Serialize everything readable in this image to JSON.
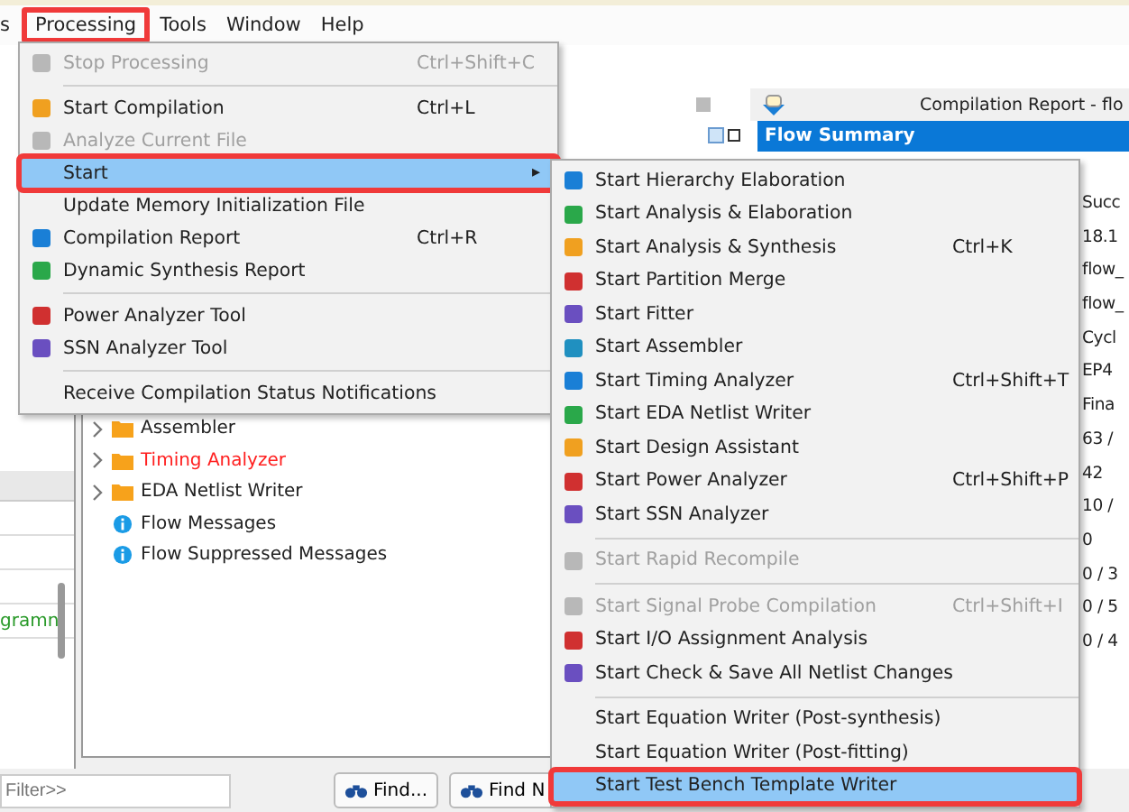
{
  "menubar": [
    {
      "label": "s",
      "annotated": false
    },
    {
      "label": "Processing",
      "annotated": true
    },
    {
      "label": "Tools",
      "annotated": false
    },
    {
      "label": "Window",
      "annotated": false
    },
    {
      "label": "Help",
      "annotated": false
    }
  ],
  "processing_menu": [
    {
      "kind": "item",
      "label": "Stop Processing",
      "shortcut": "Ctrl+Shift+C",
      "disabled": true,
      "selected": false,
      "annotated": false,
      "has_icon": true
    },
    {
      "kind": "separator"
    },
    {
      "kind": "item",
      "label": "Start Compilation",
      "shortcut": "Ctrl+L",
      "disabled": false,
      "selected": false,
      "annotated": false,
      "has_icon": true
    },
    {
      "kind": "item",
      "label": "Analyze Current File",
      "disabled": true,
      "selected": false,
      "annotated": false,
      "has_icon": true
    },
    {
      "kind": "submenu",
      "label": "Start",
      "arrow": "▸",
      "disabled": false,
      "selected": true,
      "annotated": true,
      "has_icon": false
    },
    {
      "kind": "item",
      "label": "Update Memory Initialization File",
      "disabled": false,
      "selected": false,
      "annotated": false,
      "has_icon": false
    },
    {
      "kind": "item",
      "label": "Compilation Report",
      "shortcut": "Ctrl+R",
      "disabled": false,
      "selected": false,
      "annotated": false,
      "has_icon": true
    },
    {
      "kind": "item",
      "label": "Dynamic Synthesis Report",
      "disabled": false,
      "selected": false,
      "annotated": false,
      "has_icon": true
    },
    {
      "kind": "separator"
    },
    {
      "kind": "item",
      "label": "Power Analyzer Tool",
      "disabled": false,
      "selected": false,
      "annotated": false,
      "has_icon": true
    },
    {
      "kind": "item",
      "label": "SSN Analyzer Tool",
      "disabled": false,
      "selected": false,
      "annotated": false,
      "has_icon": true
    },
    {
      "kind": "separator"
    },
    {
      "kind": "item",
      "label": "Receive Compilation Status Notifications",
      "disabled": false,
      "selected": false,
      "annotated": false,
      "has_icon": false
    }
  ],
  "start_submenu": [
    {
      "kind": "item",
      "label": "Start Hierarchy Elaboration",
      "disabled": false,
      "selected": false,
      "annotated": false,
      "has_icon": true
    },
    {
      "kind": "item",
      "label": "Start Analysis & Elaboration",
      "disabled": false,
      "selected": false,
      "annotated": false,
      "has_icon": true
    },
    {
      "kind": "item",
      "label": "Start Analysis & Synthesis",
      "shortcut": "Ctrl+K",
      "disabled": false,
      "selected": false,
      "annotated": false,
      "has_icon": true
    },
    {
      "kind": "item",
      "label": "Start Partition Merge",
      "disabled": false,
      "selected": false,
      "annotated": false,
      "has_icon": true
    },
    {
      "kind": "item",
      "label": "Start Fitter",
      "disabled": false,
      "selected": false,
      "annotated": false,
      "has_icon": true
    },
    {
      "kind": "item",
      "label": "Start Assembler",
      "disabled": false,
      "selected": false,
      "annotated": false,
      "has_icon": true
    },
    {
      "kind": "item",
      "label": "Start Timing Analyzer",
      "shortcut": "Ctrl+Shift+T",
      "disabled": false,
      "selected": false,
      "annotated": false,
      "has_icon": true
    },
    {
      "kind": "item",
      "label": "Start EDA Netlist Writer",
      "disabled": false,
      "selected": false,
      "annotated": false,
      "has_icon": true
    },
    {
      "kind": "item",
      "label": "Start Design Assistant",
      "disabled": false,
      "selected": false,
      "annotated": false,
      "has_icon": true
    },
    {
      "kind": "item",
      "label": "Start Power Analyzer",
      "shortcut": "Ctrl+Shift+P",
      "disabled": false,
      "selected": false,
      "annotated": false,
      "has_icon": true
    },
    {
      "kind": "item",
      "label": "Start SSN Analyzer",
      "disabled": false,
      "selected": false,
      "annotated": false,
      "has_icon": true
    },
    {
      "kind": "separator"
    },
    {
      "kind": "item",
      "label": "Start Rapid Recompile",
      "disabled": true,
      "selected": false,
      "annotated": false,
      "has_icon": true
    },
    {
      "kind": "separator"
    },
    {
      "kind": "item",
      "label": "Start Signal Probe Compilation",
      "shortcut": "Ctrl+Shift+I",
      "disabled": true,
      "selected": false,
      "annotated": false,
      "has_icon": true
    },
    {
      "kind": "item",
      "label": "Start I/O Assignment Analysis",
      "disabled": false,
      "selected": false,
      "annotated": false,
      "has_icon": true
    },
    {
      "kind": "item",
      "label": "Start Check & Save All Netlist Changes",
      "disabled": false,
      "selected": false,
      "annotated": false,
      "has_icon": true
    },
    {
      "kind": "separator"
    },
    {
      "kind": "item",
      "label": "Start Equation Writer (Post-synthesis)",
      "disabled": false,
      "selected": false,
      "annotated": false,
      "has_icon": false
    },
    {
      "kind": "item",
      "label": "Start Equation Writer (Post-fitting)",
      "disabled": false,
      "selected": false,
      "annotated": false,
      "has_icon": false
    },
    {
      "kind": "item",
      "label": "Start Test Bench Template Writer",
      "disabled": false,
      "selected": true,
      "annotated": true,
      "has_icon": false
    }
  ],
  "left_panel": {
    "text": "gramn"
  },
  "task_tree": [
    {
      "kind": "folder",
      "label": "Assembler",
      "color": "#222222"
    },
    {
      "kind": "folder",
      "label": "Timing Analyzer",
      "color": "#ff2020"
    },
    {
      "kind": "folder",
      "label": "EDA Netlist Writer",
      "color": "#222222"
    },
    {
      "kind": "info",
      "label": "Flow Messages",
      "color": "#222222"
    },
    {
      "kind": "info",
      "label": "Flow Suppressed Messages",
      "color": "#222222"
    }
  ],
  "report": {
    "title": "Compilation Report - flo",
    "section": "Flow Summary",
    "values": [
      "Succ",
      "18.1",
      "flow_",
      "flow_",
      "Cycl",
      "EP4",
      "Fina",
      "63 /",
      "42",
      "10 /",
      "0",
      "0 / 3",
      "0 / 5",
      "0 / 4"
    ]
  },
  "bottom": {
    "filter_placeholder": "Filter>>",
    "buttons": [
      "Find...",
      "Find N"
    ]
  }
}
